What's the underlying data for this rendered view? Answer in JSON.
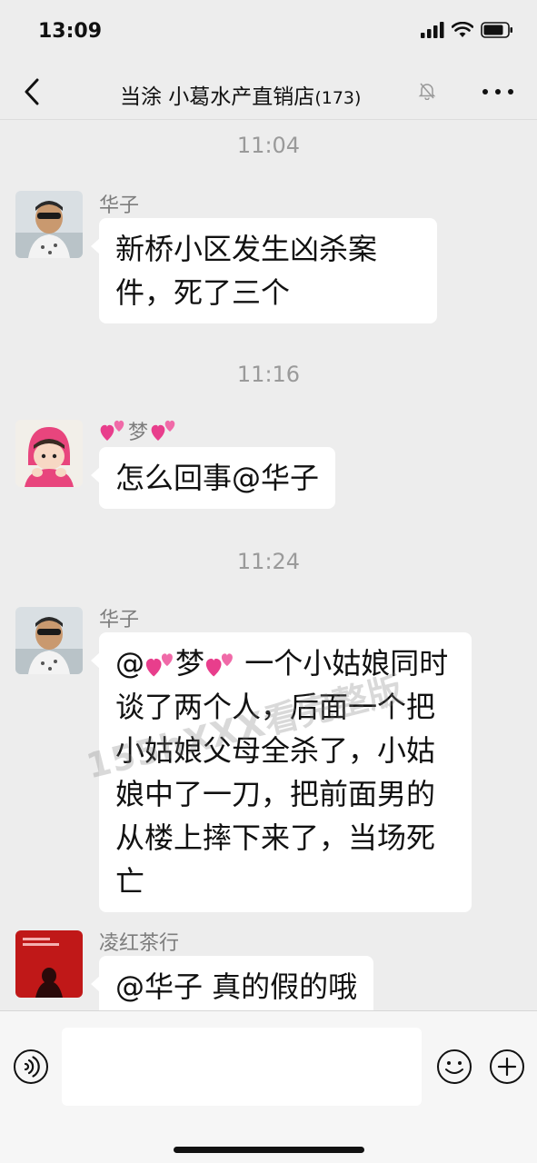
{
  "status_bar": {
    "time": "13:09"
  },
  "nav": {
    "title": "当涂 小葛水产直销店",
    "member_count": "(173)",
    "back_icon": "chevron-left-icon",
    "more_icon": "more-dots-icon",
    "mute_icon": "mute-bell-icon"
  },
  "messages": [
    {
      "time": "11:04",
      "sender": "华子",
      "text": "新桥小区发生凶杀案件，死了三个"
    },
    {
      "time": "11:16",
      "sender": "梦",
      "text": "怎么回事@华子"
    },
    {
      "time": "11:24",
      "sender": "华子",
      "mention": "@",
      "mention_name": "梦",
      "text": "一个小姑娘同时谈了两个人，后面一个把小姑娘父母全杀了，小姑娘中了一刀，把前面男的从楼上摔下来了，当场死亡"
    },
    {
      "sender": "凌红茶行",
      "text": "@华子 真的假的哦"
    }
  ],
  "watermark": "155hXXX看完整版",
  "input_bar": {
    "voice_icon": "voice-icon",
    "emoji_icon": "emoji-icon",
    "plus_icon": "plus-icon"
  },
  "colors": {
    "background": "#ededed",
    "bubble": "#ffffff",
    "meta_text": "#9a9a9a",
    "heart": "#e83e8c"
  }
}
